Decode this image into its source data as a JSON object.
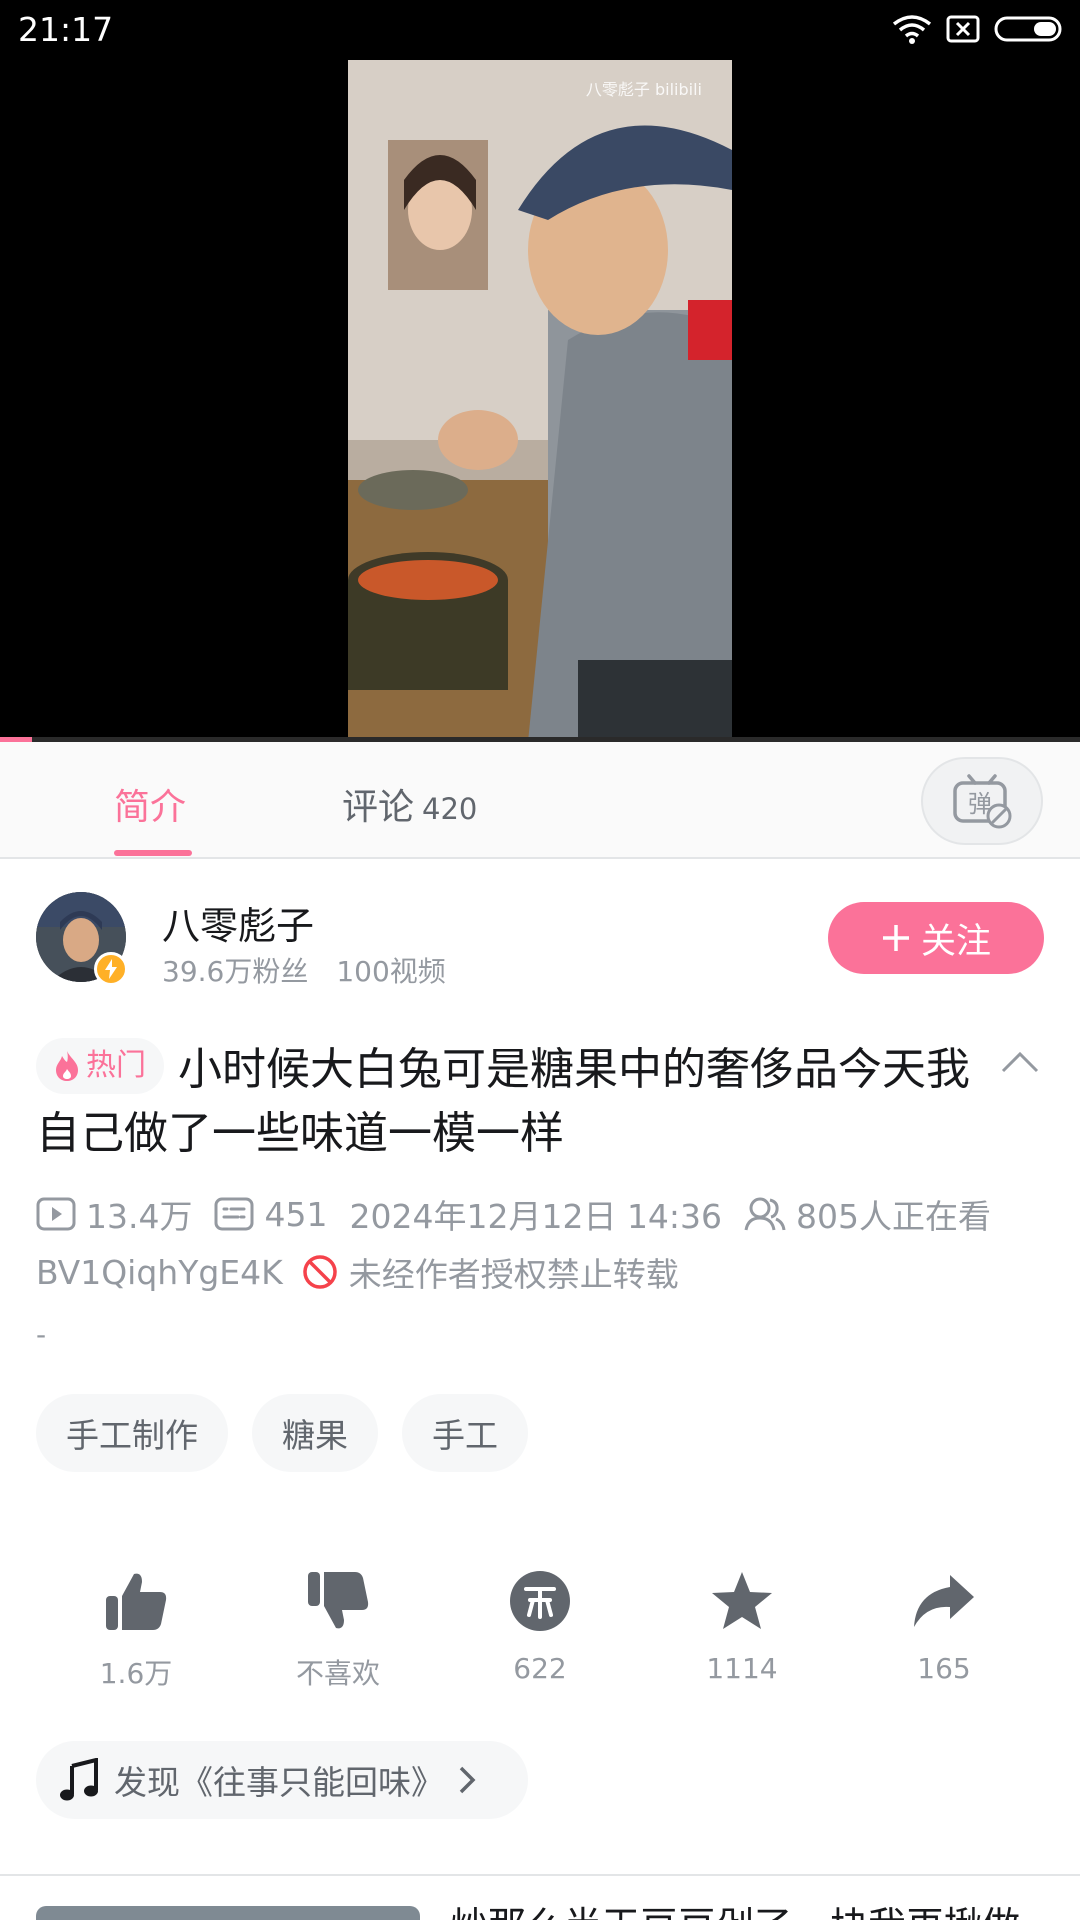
{
  "status_bar": {
    "time": "21:17",
    "icons": [
      "wifi-icon",
      "sim-blocked-icon",
      "battery-icon"
    ]
  },
  "video": {
    "watermark": "八零彪子 bilibili",
    "progress_fraction": 0.03
  },
  "tabs": {
    "intro_label": "简介",
    "comments_label": "评论",
    "comments_count": "420",
    "danmaku_label": "弹"
  },
  "uploader": {
    "name": "八零彪子",
    "fans": "39.6万粉丝",
    "videos": "100视频",
    "follow_label": "关注"
  },
  "title": {
    "hot_label": "热门",
    "text": "小时候大白兔可是糖果中的奢侈品今天我自己做了一些味道一模一样"
  },
  "meta": {
    "views": "13.4万",
    "danmaku": "451",
    "date": "2024年12月12日 14:36",
    "watching": "805人正在看",
    "bvid": "BV1QiqhYgE4K",
    "no_repost": "未经作者授权禁止转载",
    "description": "-"
  },
  "tags": [
    "手工制作",
    "糖果",
    "手工"
  ],
  "actions": {
    "like": "1.6万",
    "dislike": "不喜欢",
    "coin": "622",
    "favorite": "1114",
    "share": "165"
  },
  "music": {
    "label": "发现《往事只能回味》"
  },
  "recommend": {
    "title": "炒那么半天豆豆剁了一块我再揪做"
  },
  "colors": {
    "accent": "#fb7299",
    "text_secondary": "#9499a0",
    "chip_bg": "#f6f7f8"
  }
}
